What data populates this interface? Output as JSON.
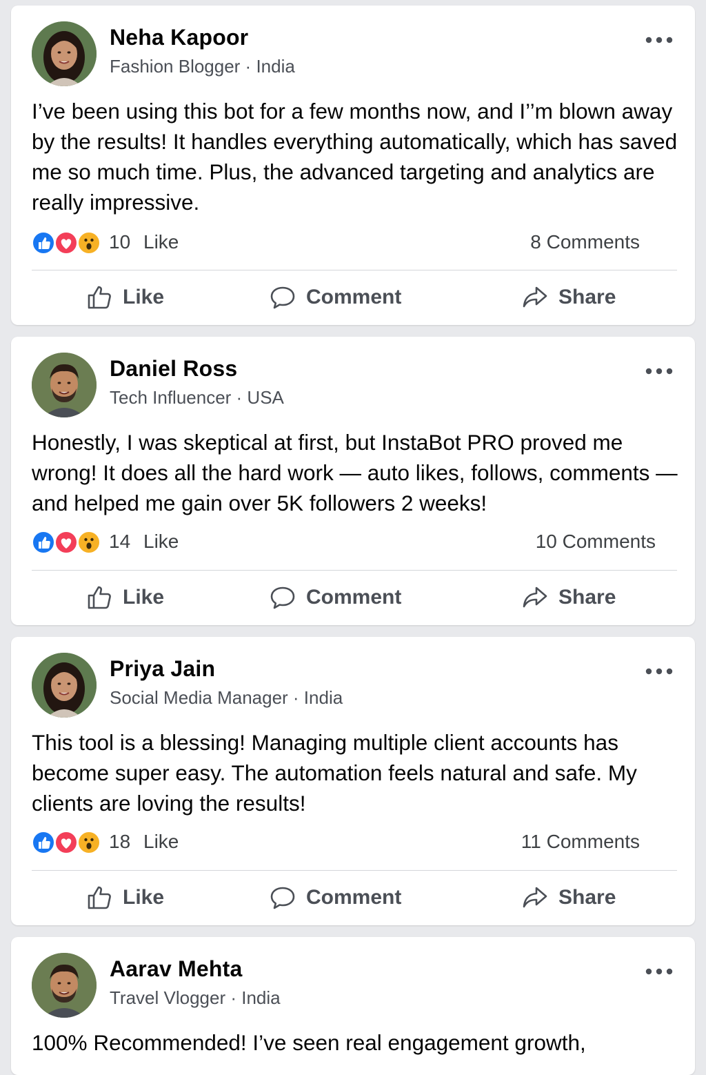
{
  "posts": [
    {
      "author": "Neha Kapoor",
      "meta": "Fashion Blogger · India",
      "text": "I’ve been using this bot for a few months now, and I’’m blown away by the results! It handles everything automatically, which has saved me so much time. Plus, the advanced targeting and analytics are really impressive.",
      "like_count": "10",
      "like_word": "Like",
      "comments": "8 Comments",
      "actions": {
        "like": "Like",
        "comment": "Comment",
        "share": "Share"
      }
    },
    {
      "author": "Daniel Ross",
      "meta": "Tech Influencer · USA",
      "text": "Honestly, I was skeptical at first, but InstaBot PRO proved me wrong! It does all the hard work — auto likes, follows, comments — and helped me gain over 5K followers 2 weeks!",
      "like_count": "14",
      "like_word": "Like",
      "comments": "10 Comments",
      "actions": {
        "like": "Like",
        "comment": "Comment",
        "share": "Share"
      }
    },
    {
      "author": "Priya Jain",
      "meta": "Social Media Manager · India",
      "text": "This tool is a blessing! Managing multiple client accounts has become super easy. The automation feels natural and safe. My clients are loving the results!",
      "like_count": "18",
      "like_word": "Like",
      "comments": "11 Comments",
      "actions": {
        "like": "Like",
        "comment": "Comment",
        "share": "Share"
      }
    },
    {
      "author": "Aarav Mehta",
      "meta": "Travel Vlogger · India",
      "text": "100% Recommended! I’ve seen real engagement growth,"
    }
  ],
  "icons": {
    "reaction_like": "thumbs-up-reaction",
    "reaction_love": "heart-reaction",
    "reaction_wow": "wow-reaction",
    "action_like": "thumbs-up-outline",
    "action_comment": "speech-bubble-outline",
    "action_share": "share-arrow-outline",
    "more": "horizontal-ellipsis"
  },
  "colors": {
    "like_blue": "#1877f2",
    "love_red": "#f33e58",
    "wow_yellow": "#f7b125",
    "background": "#e8e9ec",
    "card": "#ffffff"
  }
}
